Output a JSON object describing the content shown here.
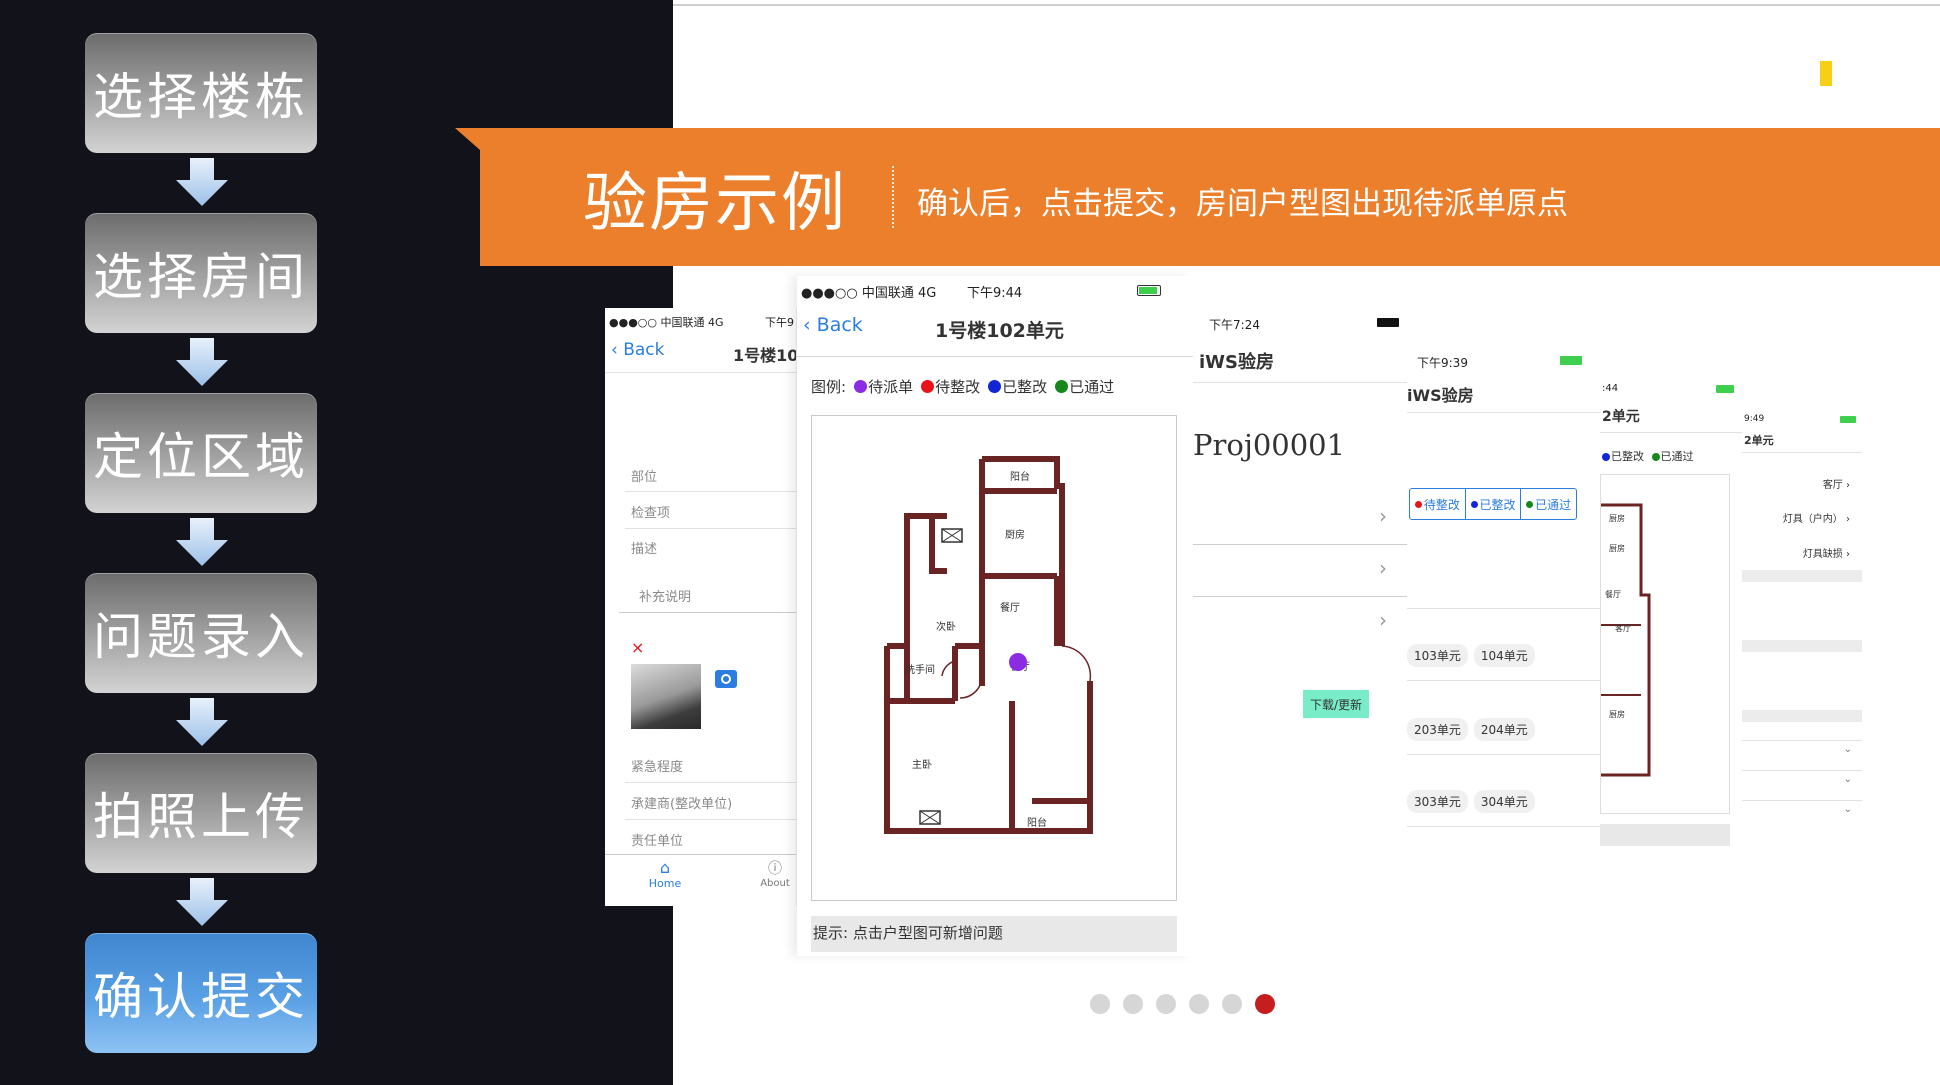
{
  "steps": [
    "选择楼栋",
    "选择房间",
    "定位区域",
    "问题录入",
    "拍照上传",
    "确认提交"
  ],
  "banner": {
    "title": "验房示例",
    "subtitle": "确认后，点击提交，房间户型图出现待派单原点"
  },
  "screen1": {
    "carrier": "●●●○○ 中国联通  4G",
    "time": "下午9",
    "back": "Back",
    "title": "1号楼10",
    "fields": [
      "部位",
      "检查项",
      "描述",
      "补充说明"
    ],
    "delete_glyph": "×",
    "fields2": [
      "紧急程度",
      "承建商(整改单位)",
      "责任单位"
    ],
    "tabs": [
      "Home",
      "About"
    ]
  },
  "screen2": {
    "carrier": "●●●○○ 中国联通   4G",
    "time": "下午9:44",
    "back": "Back",
    "title": "1号楼102单元",
    "legend_label": "图例:",
    "legend": [
      {
        "label": "待派单",
        "color": "#8b2be2"
      },
      {
        "label": "待整改",
        "color": "#e8141b"
      },
      {
        "label": "已整改",
        "color": "#1226d6"
      },
      {
        "label": "已通过",
        "color": "#17881c"
      }
    ],
    "rooms": [
      "阳台",
      "厨房",
      "次卧",
      "餐厅",
      "洗手间",
      "客厅",
      "主卧",
      "阳台"
    ],
    "hint": "提示: 点击户型图可新增问题"
  },
  "screen3": {
    "time": "下午7:24",
    "title": "iWS验房",
    "project": "Proj00001",
    "button": "下载/更新"
  },
  "screen4": {
    "time": "下午9:39",
    "title": "iWS验房",
    "filters": [
      "待整改",
      "已整改",
      "已通过"
    ],
    "filter_colors": [
      "#e8141b",
      "#1226d6",
      "#17881c"
    ],
    "rows": [
      [
        "103单元",
        "104单元"
      ],
      [
        "203单元",
        "204单元"
      ],
      [
        "303单元",
        "304单元"
      ]
    ]
  },
  "screen5": {
    "time": ":44",
    "title": "2单元",
    "legend": [
      "已整改",
      "已通过"
    ],
    "rooms": [
      "厨房",
      "厨房",
      "餐厅",
      "客厅",
      "厨房"
    ]
  },
  "screen6": {
    "time": "9:49",
    "title": "2单元",
    "items": [
      "客厅",
      "灯具（户内）",
      "灯具缺损"
    ]
  },
  "pagination": {
    "count": 6,
    "active": 6
  },
  "colors": {
    "accent": "#ec7f2c",
    "panel": "#12131a",
    "active_dot": "#c51e1e"
  }
}
